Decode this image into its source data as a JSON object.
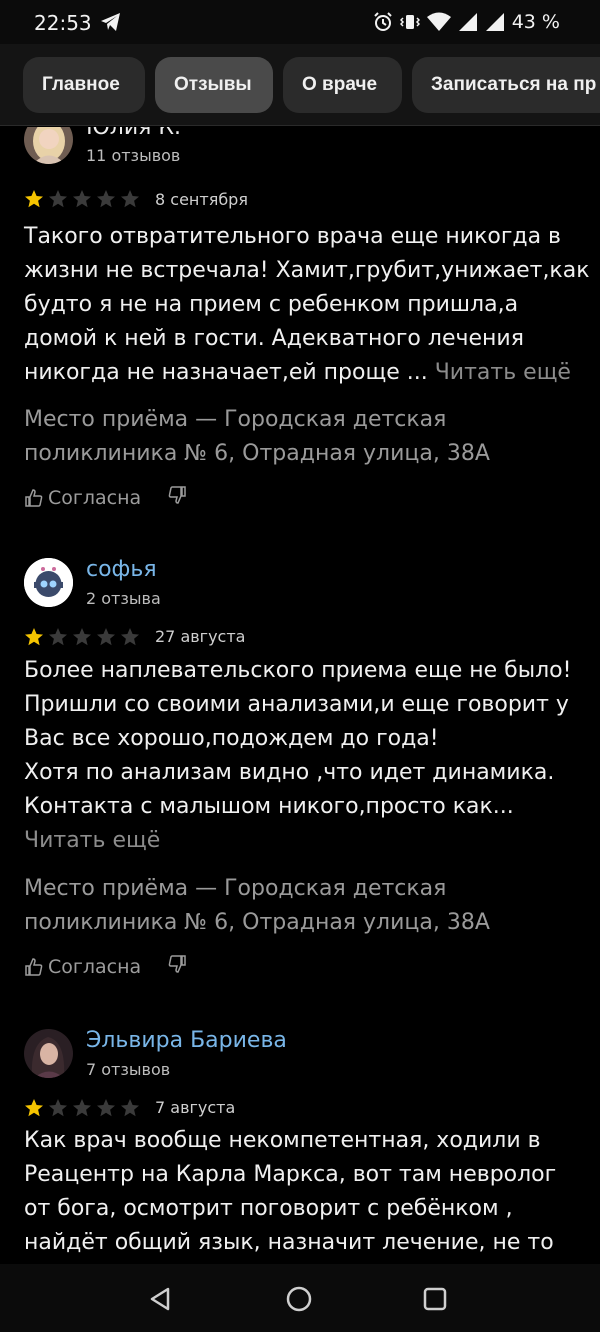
{
  "status_bar": {
    "time": "22:53",
    "battery": "43 %",
    "icons": [
      "telegram-icon",
      "alarm-icon",
      "vibrate-icon",
      "wifi-icon",
      "signal-icon",
      "signal-icon"
    ]
  },
  "tabs": [
    {
      "label": "Главное",
      "active": false
    },
    {
      "label": "Отзывы",
      "active": true
    },
    {
      "label": "О враче",
      "active": false
    },
    {
      "label": "Записаться на пр",
      "active": false
    }
  ],
  "reviews": [
    {
      "author": "Юлия К.",
      "reviews_count": "11 отзывов",
      "rating": 1,
      "date": "8 сентября",
      "text_lines": [
        "Такого отвратительного врача еще никогда в",
        "жизни не встречала! Хамит,грубит,унижает,как",
        "будто я не на прием с ребенком пришла,а",
        "домой к ней в гости. Адекватного лечения",
        "никогда не назначает,ей проще ..."
      ],
      "read_more": "Читать ещё",
      "place_lines": [
        "Место приёма — Городская детская",
        "поликлиника № 6, Отрадная улица, 38А"
      ],
      "agree_label": "Согласна"
    },
    {
      "author": "софья",
      "reviews_count": "2 отзыва",
      "rating": 1,
      "date": "27 августа",
      "text_lines": [
        "Более наплевательского приема еще не было!",
        "Пришли со своими анализами,и еще говорит у",
        "Вас все хорошо,подождем до года!",
        "Хотя по анализам видно ,что идет динамика.",
        "Контакта с малышом никого,просто как..."
      ],
      "read_more": "Читать ещё",
      "place_lines": [
        "Место приёма — Городская детская",
        "поликлиника № 6, Отрадная улица, 38А"
      ],
      "agree_label": "Согласна"
    },
    {
      "author": "Эльвира Бариева",
      "reviews_count": "7 отзывов",
      "rating": 1,
      "date": "7 августа",
      "text_lines": [
        "Как врач вообще некомпетентная, ходили в",
        "Реацентр на Карла Маркса, вот там невролог",
        "от бога, осмотрит поговорит с ребёнком ,",
        "найдёт общий язык, назначит лечение, не то"
      ]
    }
  ],
  "colors": {
    "star_filled": "#f5c400",
    "star_empty": "#3a3a3a",
    "link": "#79b6e8",
    "background": "#000000"
  }
}
